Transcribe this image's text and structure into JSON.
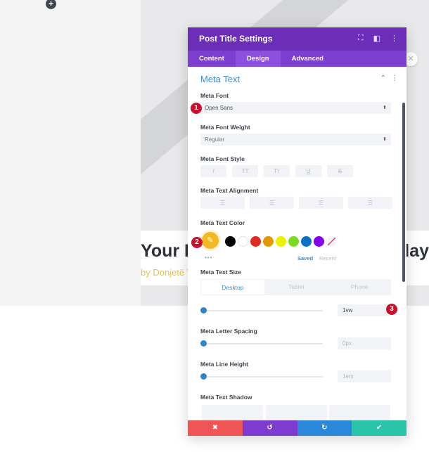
{
  "page": {
    "add_icon": "plus-icon",
    "post_title_start": "Your D",
    "post_title_end": "lay",
    "post_meta": "by Donjetë V"
  },
  "modal": {
    "title": "Post Title Settings",
    "header_icons": [
      "fullscreen-icon",
      "sidebar-icon",
      "more-vertical-icon"
    ],
    "tabs": [
      {
        "label": "Content",
        "active": false
      },
      {
        "label": "Design",
        "active": true
      },
      {
        "label": "Advanced",
        "active": false
      }
    ],
    "section": {
      "title": "Meta Text"
    },
    "fields": {
      "meta_font": {
        "label": "Meta Font",
        "value": "Open Sans"
      },
      "meta_font_weight": {
        "label": "Meta Font Weight",
        "value": "Regular"
      },
      "meta_font_style": {
        "label": "Meta Font Style",
        "buttons": [
          "I",
          "TT",
          "Tт",
          "U",
          "S"
        ]
      },
      "meta_text_alignment": {
        "label": "Meta Text Alignment",
        "buttons": [
          "left",
          "center",
          "right",
          "justify"
        ]
      },
      "meta_text_color": {
        "label": "Meta Text Color",
        "selected": "#f4b823",
        "swatches": [
          "#000000",
          "#ffffff",
          "#e02b20",
          "#e09900",
          "#edf000",
          "#7cda24",
          "#0c71c3",
          "#8300e9"
        ],
        "more": "•••",
        "saved_label": "Saved",
        "recent_label": "Recent"
      },
      "meta_text_size": {
        "label": "Meta Text Size",
        "devices": [
          "Desktop",
          "Tablet",
          "Phone"
        ],
        "active_device": "Desktop",
        "value": "1vw",
        "slider_fraction": 0
      },
      "meta_letter_spacing": {
        "label": "Meta Letter Spacing",
        "value": "0px",
        "slider_fraction": 0
      },
      "meta_line_height": {
        "label": "Meta Line Height",
        "value": "1em",
        "slider_fraction": 0
      },
      "meta_text_shadow": {
        "label": "Meta Text Shadow"
      }
    },
    "footer": {
      "cancel_icon": "✖",
      "undo_icon": "↺",
      "redo_icon": "↻",
      "save_icon": "✔",
      "colors": {
        "cancel": "#ef5555",
        "undo": "#7d3bcf",
        "redo": "#2b87da",
        "save": "#29c4a9"
      }
    }
  },
  "annotations": [
    "1",
    "2",
    "3"
  ]
}
